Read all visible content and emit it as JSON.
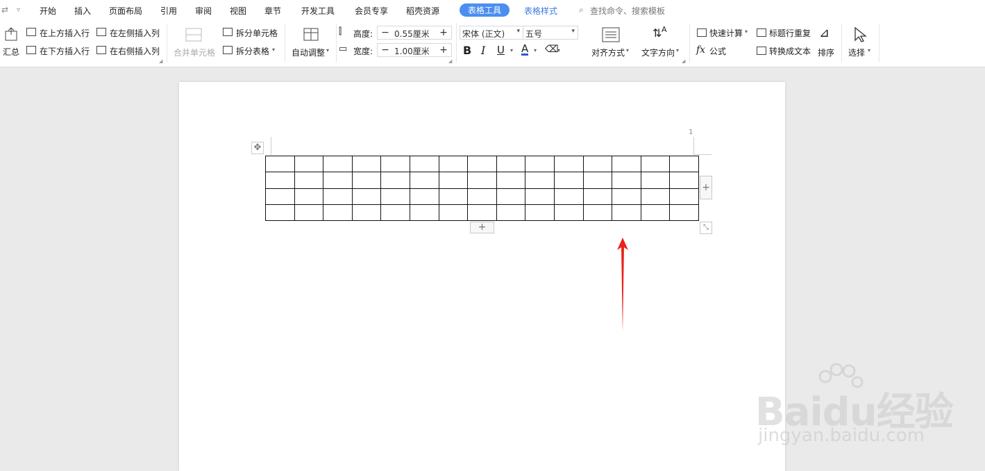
{
  "menu": {
    "items": [
      "开始",
      "插入",
      "页面布局",
      "引用",
      "审阅",
      "视图",
      "章节",
      "开发工具",
      "会员专享",
      "稻壳资源"
    ],
    "active_tab": "表格工具",
    "style_tab": "表格样式",
    "search": "查找命令、搜索模板"
  },
  "ribbon": {
    "summary": "汇总",
    "insert_above": "在上方插入行",
    "insert_below": "在下方插入行",
    "insert_left": "在左侧插入列",
    "insert_right": "在右侧插入列",
    "merge_cells": "合并单元格",
    "split_cells": "拆分单元格",
    "split_table": "拆分表格",
    "auto_adjust": "自动调整",
    "height_label": "高度:",
    "height_value": "0.55厘米",
    "width_label": "宽度:",
    "width_value": "1.00厘米",
    "font_name": "宋体 (正文)",
    "font_size": "五号",
    "align": "对齐方式",
    "text_direction": "文字方向",
    "quick_calc": "快速计算",
    "formula": "公式",
    "header_repeat": "标题行重复",
    "convert_text": "转换成文本",
    "sort": "排序",
    "select": "选择"
  },
  "document": {
    "ruler_number": "1",
    "table": {
      "rows": 4,
      "cols": 15
    }
  },
  "watermark": {
    "brand": "Baidu经验",
    "url": "jingyan.baidu.com"
  },
  "colors": {
    "accent": "#4a8ef0",
    "arrow": "#e8241c"
  }
}
